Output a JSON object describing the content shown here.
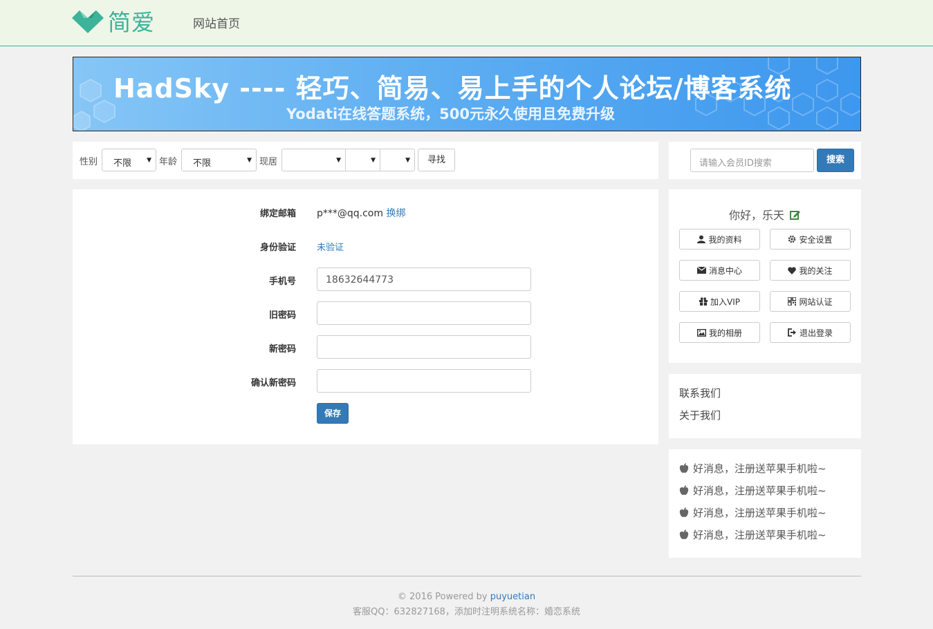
{
  "header": {
    "logo_text": "简爱",
    "nav_home": "网站首页"
  },
  "banner": {
    "title": "HadSky ---- 轻巧、简易、易上手的个人论坛/博客系统",
    "subtitle": "Yodati在线答题系统，500元永久使用且免费升级"
  },
  "filter": {
    "gender_label": "性别",
    "gender_value": "不限",
    "age_label": "年龄",
    "age_value": "不限",
    "residence_label": "现居",
    "province_value": "",
    "city_value": "",
    "district_value": "",
    "find_button": "寻找"
  },
  "search": {
    "placeholder": "请输入会员ID搜索",
    "button": "搜索"
  },
  "account_form": {
    "email_label": "绑定邮箱",
    "email_value": "p***@qq.com",
    "email_change": "换绑",
    "identity_label": "身份验证",
    "identity_value": "未验证",
    "phone_label": "手机号",
    "phone_value": "18632644773",
    "old_password_label": "旧密码",
    "old_password_value": "",
    "new_password_label": "新密码",
    "new_password_value": "",
    "confirm_password_label": "确认新密码",
    "confirm_password_value": "",
    "save_button": "保存"
  },
  "user_panel": {
    "greeting": "你好，乐天",
    "buttons": [
      {
        "label": "我的资料",
        "icon": "user-icon"
      },
      {
        "label": "安全设置",
        "icon": "gear-icon"
      },
      {
        "label": "消息中心",
        "icon": "envelope-icon"
      },
      {
        "label": "我的关注",
        "icon": "heart-icon"
      },
      {
        "label": "加入VIP",
        "icon": "gift-icon"
      },
      {
        "label": "网站认证",
        "icon": "qrcode-icon"
      },
      {
        "label": "我的相册",
        "icon": "picture-icon"
      },
      {
        "label": "退出登录",
        "icon": "logout-icon"
      }
    ]
  },
  "links_panel": {
    "contact": "联系我们",
    "about": "关于我们"
  },
  "news_panel": {
    "items": [
      "好消息，注册送苹果手机啦~",
      "好消息，注册送苹果手机啦~",
      "好消息，注册送苹果手机啦~",
      "好消息，注册送苹果手机啦~"
    ]
  },
  "footer": {
    "copyright_prefix": "© 2016 Powered by ",
    "powered_link": "puyuetian",
    "contact_line": "客服QQ：632827168，添加时注明系统名称：婚恋系统"
  },
  "colors": {
    "brand": "#3db39a",
    "primary_button": "#337ab7",
    "link": "#337ab7",
    "header_bg": "#eef6e8",
    "page_bg": "#f1f1f1"
  }
}
